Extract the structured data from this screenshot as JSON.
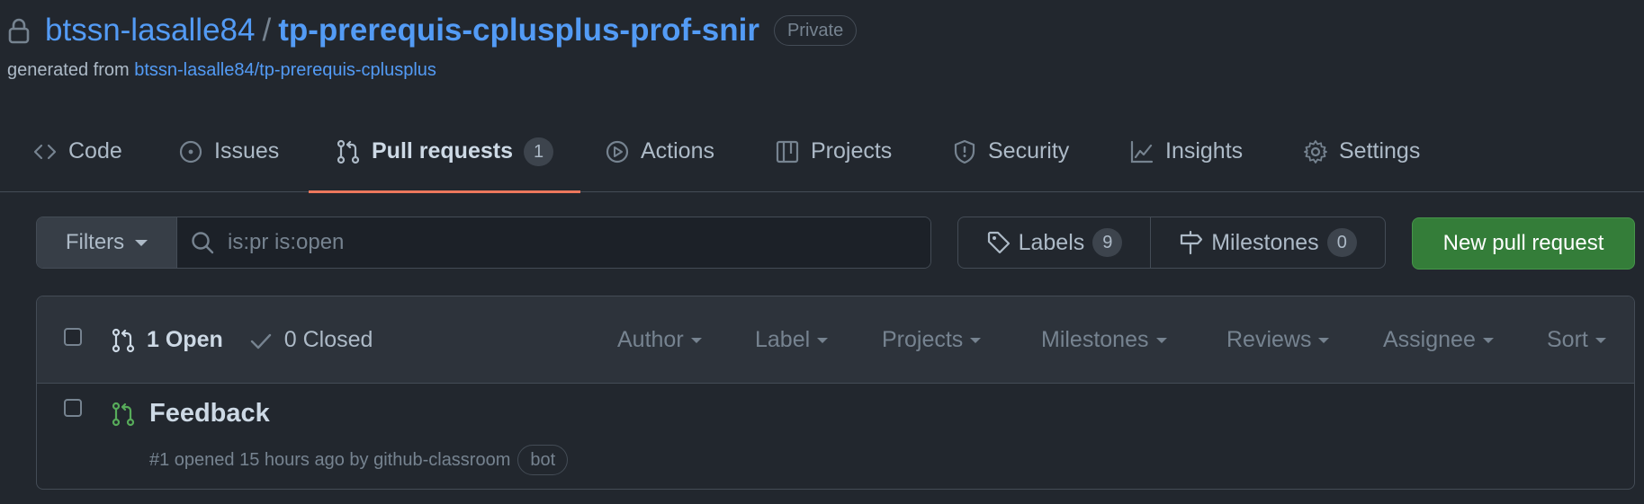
{
  "repo": {
    "owner": "btssn-lasalle84",
    "separator": "/",
    "name": "tp-prerequis-cplusplus-prof-snir",
    "visibility": "Private",
    "generated_prefix": "generated from",
    "generated_link": "btssn-lasalle84/tp-prerequis-cplusplus"
  },
  "tabs": [
    {
      "label": "Code",
      "icon": "code-icon"
    },
    {
      "label": "Issues",
      "icon": "issue-opened-icon"
    },
    {
      "label": "Pull requests",
      "icon": "git-pull-request-icon",
      "count": "1",
      "selected": true
    },
    {
      "label": "Actions",
      "icon": "play-icon"
    },
    {
      "label": "Projects",
      "icon": "table-icon"
    },
    {
      "label": "Security",
      "icon": "shield-icon"
    },
    {
      "label": "Insights",
      "icon": "graph-icon"
    },
    {
      "label": "Settings",
      "icon": "gear-icon"
    }
  ],
  "filterbar": {
    "filters_label": "Filters",
    "search_value": "is:pr is:open",
    "labels_label": "Labels",
    "labels_count": "9",
    "milestones_label": "Milestones",
    "milestones_count": "0",
    "new_pr_label": "New pull request"
  },
  "list": {
    "open_label": "1 Open",
    "closed_label": "0 Closed",
    "sort_menus": [
      "Author",
      "Label",
      "Projects",
      "Milestones",
      "Reviews",
      "Assignee",
      "Sort"
    ],
    "items": [
      {
        "title": "Feedback",
        "meta": "#1 opened 15 hours ago by github-classroom",
        "badge": "bot"
      }
    ]
  },
  "colors": {
    "background": "#22272e",
    "link": "#539bf5",
    "selected_tab_underline": "#ec775c",
    "primary_button": "#347d39",
    "open_pr_icon": "#57ab5a"
  }
}
